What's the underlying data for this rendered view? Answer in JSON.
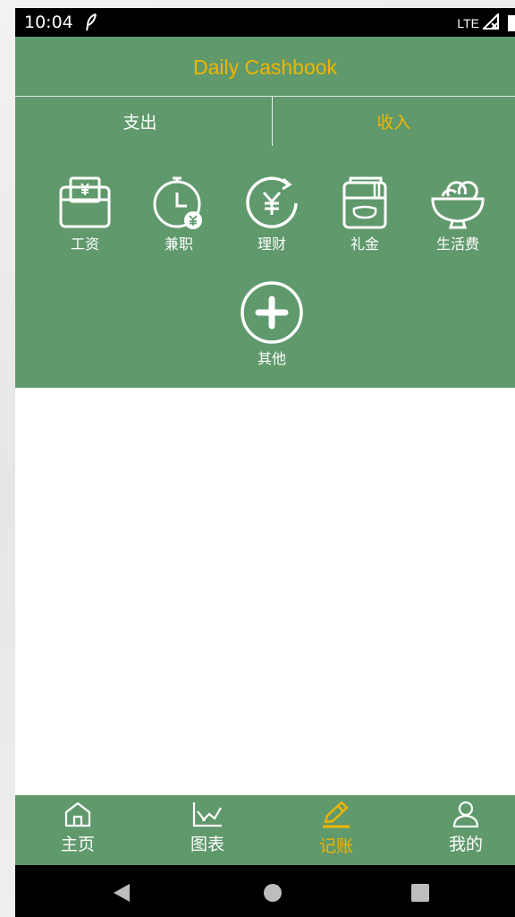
{
  "status_bar": {
    "time": "10:04",
    "network": "LTE"
  },
  "app": {
    "title": "Daily Cashbook"
  },
  "tabs": [
    {
      "label": "支出",
      "active": false
    },
    {
      "label": "收入",
      "active": true
    }
  ],
  "categories": [
    {
      "label": "工资",
      "icon": "salary-wallet-icon"
    },
    {
      "label": "兼职",
      "icon": "part-time-clock-icon"
    },
    {
      "label": "理财",
      "icon": "investment-yen-icon"
    },
    {
      "label": "礼金",
      "icon": "gift-money-icon"
    },
    {
      "label": "生活费",
      "icon": "living-expenses-bowl-icon"
    },
    {
      "label": "其他",
      "icon": "add-other-icon"
    }
  ],
  "bottom_nav": [
    {
      "label": "主页",
      "icon": "home-icon",
      "active": false
    },
    {
      "label": "图表",
      "icon": "chart-icon",
      "active": false
    },
    {
      "label": "记账",
      "icon": "pencil-icon",
      "active": true
    },
    {
      "label": "我的",
      "icon": "profile-icon",
      "active": false
    }
  ],
  "colors": {
    "header_green": "#60996c",
    "accent_yellow": "#f0b400",
    "text_white": "#ffffff"
  }
}
